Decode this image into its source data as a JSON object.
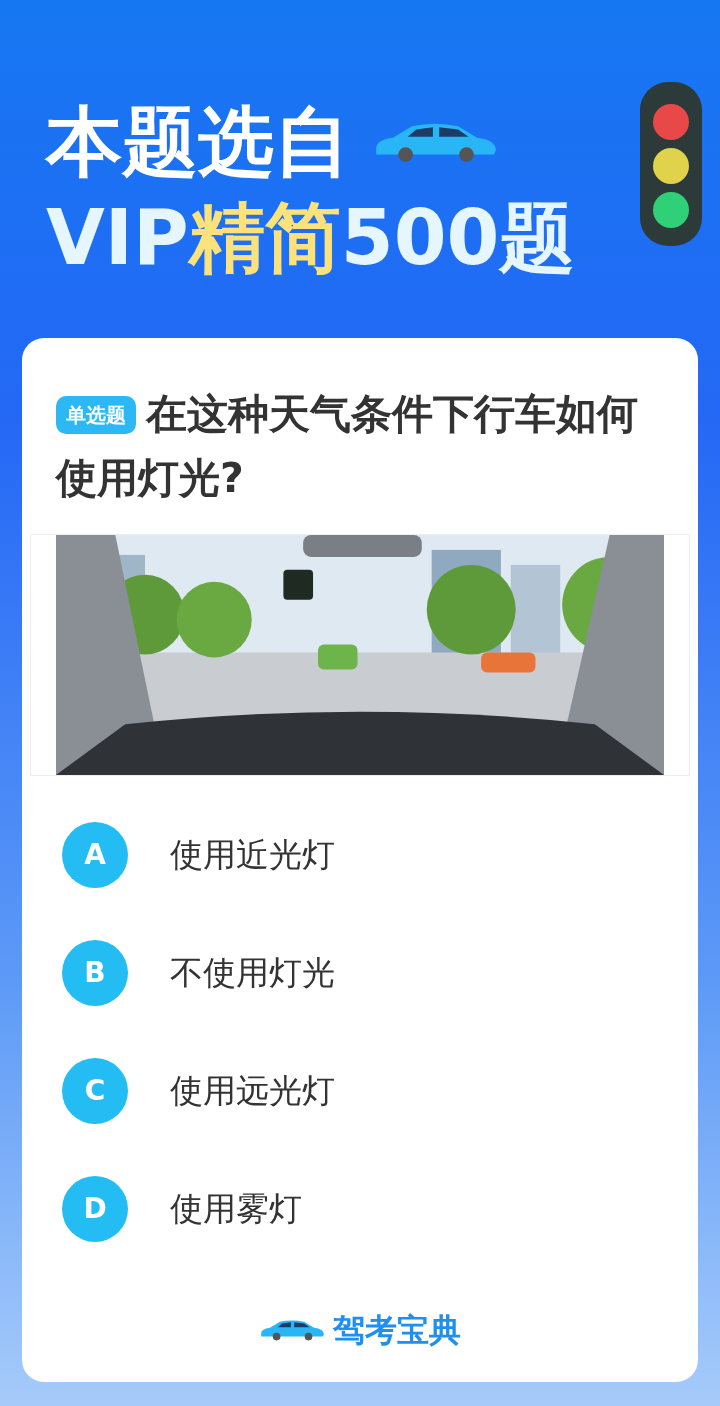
{
  "header": {
    "line1": "本题选自",
    "line2": [
      {
        "text": "VIP",
        "highlight": false
      },
      {
        "text": "精简",
        "highlight": true
      },
      {
        "text": "500题",
        "highlight": false
      }
    ]
  },
  "question": {
    "type_badge": "单选题",
    "text": "在这种天气条件下行车如何使用灯光?"
  },
  "options": [
    {
      "letter": "A",
      "text": "使用近光灯"
    },
    {
      "letter": "B",
      "text": "不使用灯光"
    },
    {
      "letter": "C",
      "text": "使用远光灯"
    },
    {
      "letter": "D",
      "text": "使用雾灯"
    }
  ],
  "footer": {
    "brand": "驾考宝典"
  }
}
